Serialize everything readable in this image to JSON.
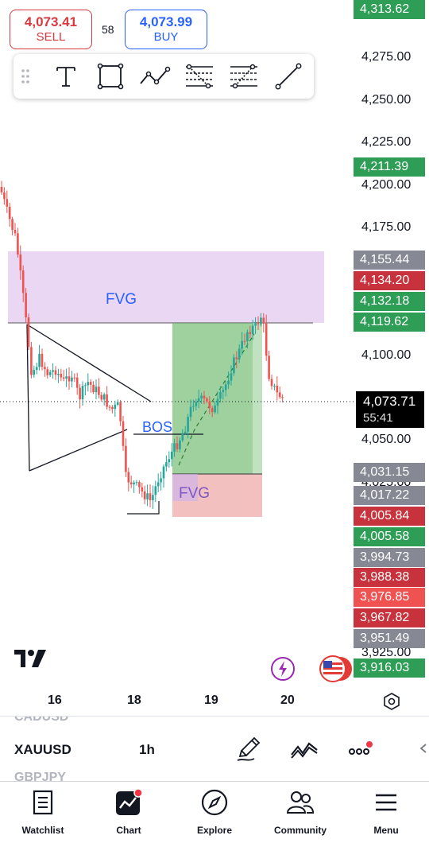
{
  "trade": {
    "sell_price": "4,073.41",
    "sell_label": "SELL",
    "spread": "58",
    "buy_price": "4,073.99",
    "buy_label": "BUY"
  },
  "toolbar": {
    "tools": [
      "drag-handle-icon",
      "text-tool-icon",
      "rectangle-tool-icon",
      "path-tool-icon",
      "fib-retracement-icon",
      "fib-extension-icon",
      "trend-line-icon"
    ]
  },
  "price_scale": {
    "labels": [
      "4,275.00",
      "4,250.00",
      "4,225.00",
      "4,200.00",
      "4,175.00",
      "4,100.00",
      "4,050.00",
      "4,025.00",
      "3,925.00"
    ]
  },
  "price_badges": [
    {
      "value": "4,313.62",
      "color": "#2e9e57"
    },
    {
      "value": "4,211.39",
      "color": "#2e9e57"
    },
    {
      "value": "4,155.44",
      "color": "#868993"
    },
    {
      "value": "4,134.20",
      "color": "#c7323c"
    },
    {
      "value": "4,132.18",
      "color": "#2e9e57"
    },
    {
      "value": "4,119.62",
      "color": "#2e9e57"
    },
    {
      "value": "4,031.15",
      "color": "#868993"
    },
    {
      "value": "4,017.22",
      "color": "#868993"
    },
    {
      "value": "4,005.84",
      "color": "#c7323c"
    },
    {
      "value": "4,005.58",
      "color": "#2e9e57"
    },
    {
      "value": "3,994.73",
      "color": "#868993"
    },
    {
      "value": "3,988.38",
      "color": "#c7323c"
    },
    {
      "value": "3,976.85",
      "color": "#f05252"
    },
    {
      "value": "3,967.82",
      "color": "#c7323c"
    },
    {
      "value": "3,951.49",
      "color": "#868993"
    },
    {
      "value": "3,916.03",
      "color": "#2e9e57"
    }
  ],
  "current_price": {
    "value": "4,073.71",
    "countdown": "55:41"
  },
  "annotations": {
    "fvg_top": "FVG",
    "bos": "BOS",
    "fvg_bottom": "FVG"
  },
  "time_axis": [
    "16",
    "18",
    "19",
    "20"
  ],
  "symbol_bar": {
    "prev_symbol": "CADUSD",
    "symbol": "XAUUSD",
    "next_symbol": "GBPJPY",
    "interval": "1h"
  },
  "nav": {
    "watchlist": "Watchlist",
    "chart": "Chart",
    "explore": "Explore",
    "community": "Community",
    "menu": "Menu"
  },
  "colors": {
    "up": "#26a69a",
    "down": "#ef5350",
    "sell": "#d9393f",
    "buy": "#2962ff"
  }
}
